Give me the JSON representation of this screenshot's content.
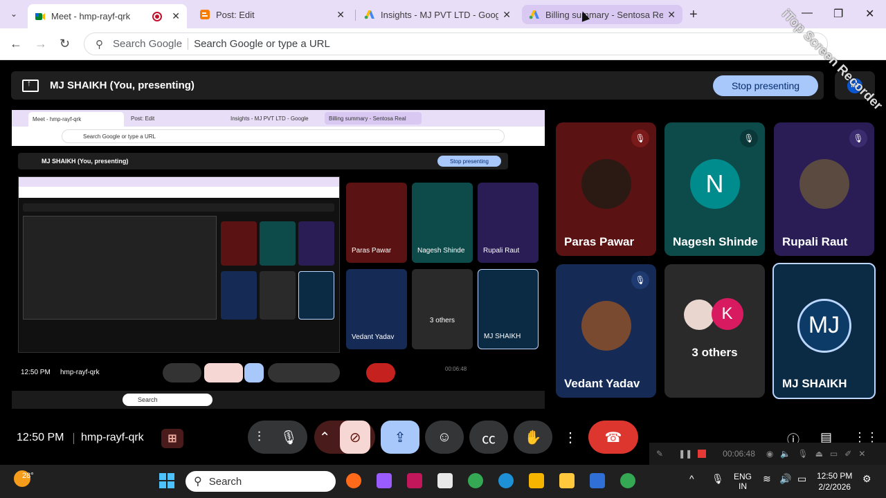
{
  "browser": {
    "tabs": [
      {
        "label": "Meet - hmp-rayf-qrk",
        "active": true
      },
      {
        "label": "Post: Edit"
      },
      {
        "label": "Insights - MJ PVT LTD - Google"
      },
      {
        "label": "Billing summary - Sentosa Real"
      }
    ],
    "omnibox": {
      "engine": "Search Google",
      "placeholder": "Search Google or type a URL"
    }
  },
  "meet": {
    "presenting_text": "MJ SHAIKH (You, presenting)",
    "stop_presenting": "Stop presenting",
    "participants": [
      {
        "name": "Paras Pawar",
        "color": "#5a1212"
      },
      {
        "name": "Nagesh Shinde",
        "initial": "N",
        "color": "#0d4b4b"
      },
      {
        "name": "Rupali Raut",
        "color": "#2a1d55"
      },
      {
        "name": "Vedant Yadav",
        "color": "#152a55"
      },
      {
        "name": "3 others",
        "initial": "K",
        "color": "#2a2a2a"
      },
      {
        "name": "MJ SHAIKH",
        "initial": "MJ",
        "color": "#0b2a44"
      }
    ],
    "time": "12:50 PM",
    "meeting_code": "hmp-rayf-qrk"
  },
  "recorder": {
    "elapsed": "00:06:48"
  },
  "watermark": "iTop Screen Recorder",
  "taskbar": {
    "weather": "28°",
    "search": "Search",
    "lang_top": "ENG",
    "lang_bottom": "IN",
    "clock_time": "12:50 PM",
    "clock_date": "2/2/2026"
  },
  "shared_screen": {
    "tiles": [
      "Paras Pawar",
      "Nagesh Shinde",
      "Rupali Raut",
      "Vedant Yadav",
      "3 others",
      "MJ SHAIKH"
    ],
    "time": "12:50 PM",
    "code": "hmp-rayf-qrk",
    "elapsed": "00:06:48",
    "search": "Search"
  }
}
